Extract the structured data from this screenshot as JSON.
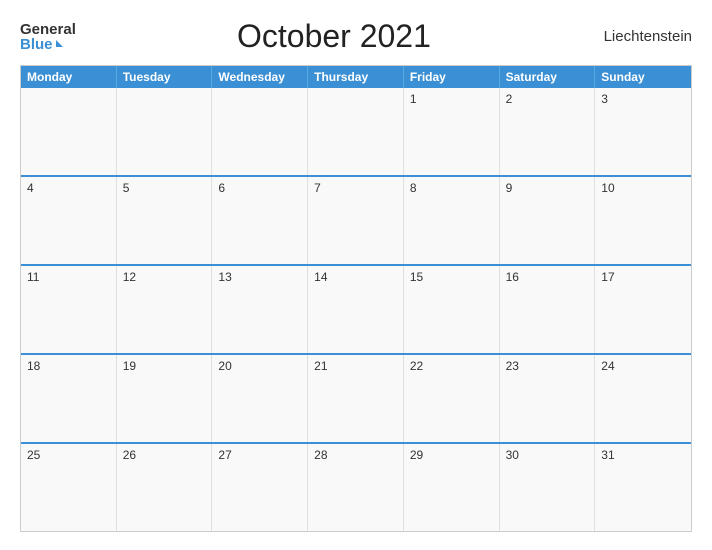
{
  "logo": {
    "general": "General",
    "blue": "Blue",
    "triangle": true
  },
  "title": "October 2021",
  "country": "Liechtenstein",
  "calendar": {
    "headers": [
      "Monday",
      "Tuesday",
      "Wednesday",
      "Thursday",
      "Friday",
      "Saturday",
      "Sunday"
    ],
    "weeks": [
      [
        {
          "day": "",
          "empty": true
        },
        {
          "day": "",
          "empty": true
        },
        {
          "day": "",
          "empty": true
        },
        {
          "day": "",
          "empty": true
        },
        {
          "day": "1"
        },
        {
          "day": "2"
        },
        {
          "day": "3"
        }
      ],
      [
        {
          "day": "4"
        },
        {
          "day": "5"
        },
        {
          "day": "6"
        },
        {
          "day": "7"
        },
        {
          "day": "8"
        },
        {
          "day": "9"
        },
        {
          "day": "10"
        }
      ],
      [
        {
          "day": "11"
        },
        {
          "day": "12"
        },
        {
          "day": "13"
        },
        {
          "day": "14"
        },
        {
          "day": "15"
        },
        {
          "day": "16"
        },
        {
          "day": "17"
        }
      ],
      [
        {
          "day": "18"
        },
        {
          "day": "19"
        },
        {
          "day": "20"
        },
        {
          "day": "21"
        },
        {
          "day": "22"
        },
        {
          "day": "23"
        },
        {
          "day": "24"
        }
      ],
      [
        {
          "day": "25"
        },
        {
          "day": "26"
        },
        {
          "day": "27"
        },
        {
          "day": "28"
        },
        {
          "day": "29"
        },
        {
          "day": "30"
        },
        {
          "day": "31"
        }
      ]
    ]
  }
}
